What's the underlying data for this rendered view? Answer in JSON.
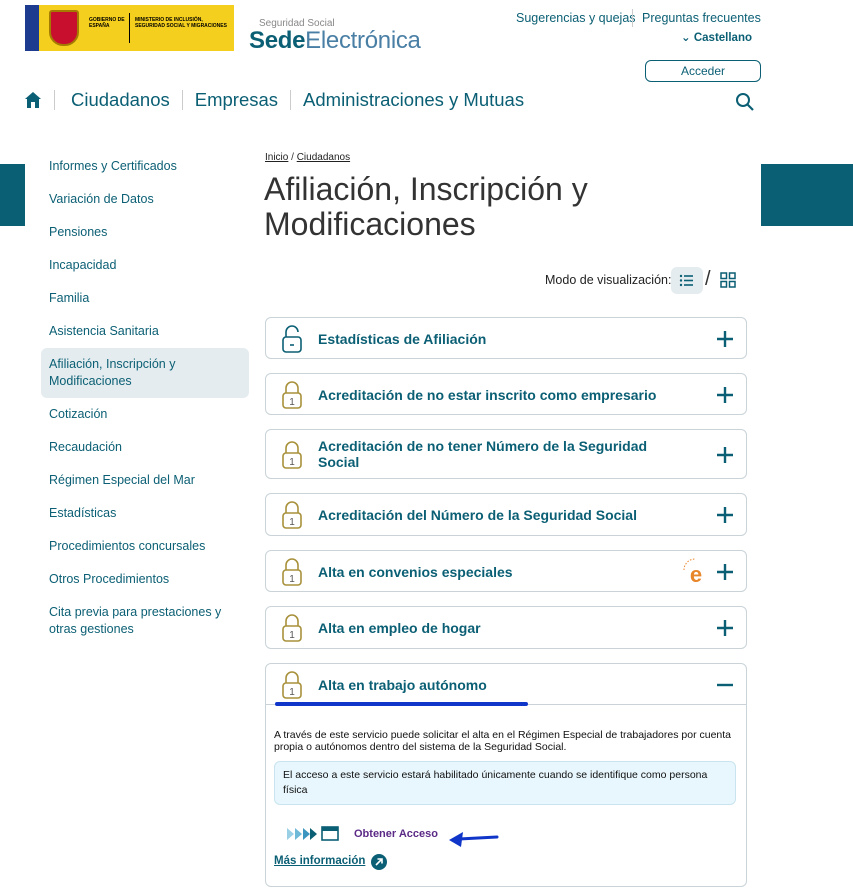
{
  "header": {
    "logo_line1": "GOBIERNO DE ESPAÑA",
    "logo_line2": "MINISTERIO DE INCLUSIÓN, SEGURIDAD SOCIAL Y MIGRACIONES",
    "brand_small": "Seguridad Social",
    "brand_bold": "Sede",
    "brand_light": "Electrónica",
    "link_sugerencias": "Sugerencias y quejas",
    "link_preguntas": "Preguntas frecuentes",
    "language": "Castellano",
    "login_button": "Acceder"
  },
  "nav": {
    "items": [
      "Ciudadanos",
      "Empresas",
      "Administraciones y Mutuas"
    ]
  },
  "sidebar": {
    "items": [
      "Informes y Certificados",
      "Variación de Datos",
      "Pensiones",
      "Incapacidad",
      "Familia",
      "Asistencia Sanitaria",
      "Afiliación, Inscripción y Modificaciones",
      "Cotización",
      "Recaudación",
      "Régimen Especial del Mar",
      "Estadísticas",
      "Procedimientos concursales",
      "Otros Procedimientos",
      "Cita previa para prestaciones y otras gestiones"
    ],
    "active_index": 6
  },
  "breadcrumb": {
    "home": "Inicio",
    "sep": "/",
    "current": "Ciudadanos"
  },
  "page_title": "Afiliación, Inscripción y Modificaciones",
  "view_mode_label": "Modo de visualización:",
  "accordion": [
    {
      "title": "Estadísticas de Afiliación",
      "lock": "open",
      "expanded": false
    },
    {
      "title": "Acreditación de no estar inscrito como empresario",
      "lock": "level-1",
      "expanded": false
    },
    {
      "title": "Acreditación de no tener Número de la Seguridad Social",
      "lock": "level-1",
      "expanded": false
    },
    {
      "title": "Acreditación del Número de la Seguridad Social",
      "lock": "level-1",
      "expanded": false
    },
    {
      "title": "Alta en convenios especiales",
      "lock": "level-1",
      "expanded": false,
      "badge": "e"
    },
    {
      "title": "Alta en empleo de hogar",
      "lock": "level-1",
      "expanded": false
    },
    {
      "title": "Alta en trabajo autónomo",
      "lock": "level-1",
      "expanded": true
    }
  ],
  "expanded": {
    "description": "A través de este servicio puede solicitar el alta en el Régimen Especial de trabajadores por cuenta propia o autónomos dentro del sistema de la Seguridad Social.",
    "notice": "El acceso a este servicio estará habilitado únicamente cuando se identifique como persona física",
    "access_link": "Obtener Acceso",
    "more_info": "Más información"
  },
  "colors": {
    "brand_teal": "#0b5f74",
    "lock_gold": "#a8913b",
    "highlight_blue": "#1036c9",
    "access_purple": "#5b2a86"
  }
}
